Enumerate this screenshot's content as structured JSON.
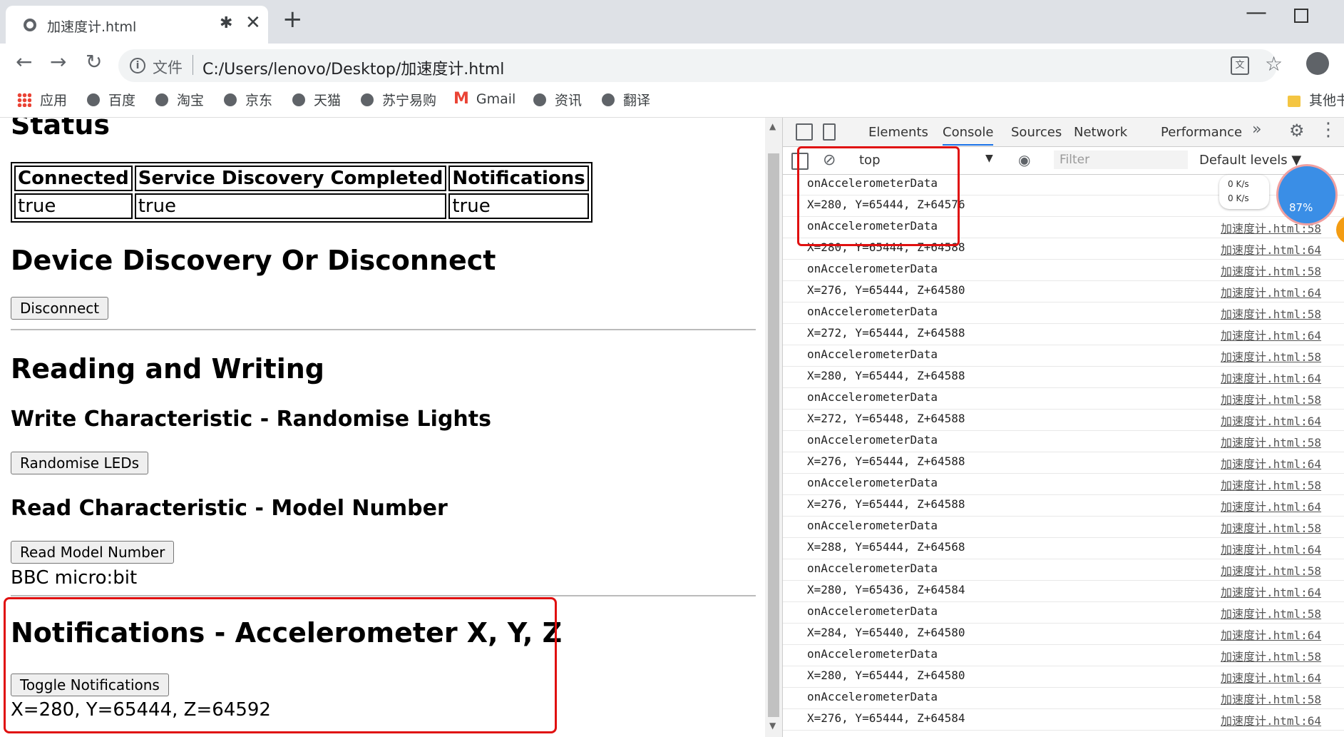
{
  "browser": {
    "tab_title": "加速度计.html",
    "tab_bt": "✱",
    "tab_close": "✕",
    "new_tab": "+",
    "file_label": "文件",
    "url": "C:/Users/lenovo/Desktop/加速度计.html",
    "bookmarks": [
      "应用",
      "百度",
      "淘宝",
      "京东",
      "天猫",
      "苏宁易购",
      "Gmail",
      "资讯",
      "翻译",
      "其他书"
    ]
  },
  "page": {
    "status_heading": "Status",
    "table_headers": [
      "Connected",
      "Service Discovery Completed",
      "Notifications"
    ],
    "table_values": [
      "true",
      "true",
      "true"
    ],
    "discovery_heading": "Device Discovery Or Disconnect",
    "disconnect_label": "Disconnect",
    "rw_heading": "Reading and Writing",
    "write_heading": "Write Characteristic - Randomise Lights",
    "randomise_label": "Randomise LEDs",
    "read_heading": "Read Characteristic - Model Number",
    "read_label": "Read Model Number",
    "model_number": "BBC micro:bit",
    "notif_heading": "Notifications - Accelerometer X, Y, Z",
    "toggle_label": "Toggle Notifications",
    "accel_reading": "X=280, Y=65444, Z=64592"
  },
  "devtools": {
    "tabs": [
      "Elements",
      "Console",
      "Sources",
      "Network",
      "Performance"
    ],
    "active_tab": "Console",
    "more_tabs": "»",
    "context": "top",
    "filter_placeholder": "Filter",
    "levels": "Default levels ▼",
    "speed_up": "0  K/s",
    "speed_down": "0  K/s",
    "ball_pct": "87%",
    "rows": [
      {
        "msg": "onAccelerometerData",
        "src": ""
      },
      {
        "msg": "X=280, Y=65444, Z+64576",
        "src": ""
      },
      {
        "msg": "onAccelerometerData",
        "src": "加速度计.html:58"
      },
      {
        "msg": "X=280, Y=65444, Z+64588",
        "src": "加速度计.html:64"
      },
      {
        "msg": "onAccelerometerData",
        "src": "加速度计.html:58"
      },
      {
        "msg": "X=276, Y=65444, Z+64580",
        "src": "加速度计.html:64"
      },
      {
        "msg": "onAccelerometerData",
        "src": "加速度计.html:58"
      },
      {
        "msg": "X=272, Y=65444, Z+64588",
        "src": "加速度计.html:64"
      },
      {
        "msg": "onAccelerometerData",
        "src": "加速度计.html:58"
      },
      {
        "msg": "X=280, Y=65444, Z+64588",
        "src": "加速度计.html:64"
      },
      {
        "msg": "onAccelerometerData",
        "src": "加速度计.html:58"
      },
      {
        "msg": "X=272, Y=65448, Z+64588",
        "src": "加速度计.html:64"
      },
      {
        "msg": "onAccelerometerData",
        "src": "加速度计.html:58"
      },
      {
        "msg": "X=276, Y=65444, Z+64588",
        "src": "加速度计.html:64"
      },
      {
        "msg": "onAccelerometerData",
        "src": "加速度计.html:58"
      },
      {
        "msg": "X=276, Y=65444, Z+64588",
        "src": "加速度计.html:64"
      },
      {
        "msg": "onAccelerometerData",
        "src": "加速度计.html:58"
      },
      {
        "msg": "X=288, Y=65444, Z+64568",
        "src": "加速度计.html:64"
      },
      {
        "msg": "onAccelerometerData",
        "src": "加速度计.html:58"
      },
      {
        "msg": "X=280, Y=65436, Z+64584",
        "src": "加速度计.html:64"
      },
      {
        "msg": "onAccelerometerData",
        "src": "加速度计.html:58"
      },
      {
        "msg": "X=284, Y=65440, Z+64580",
        "src": "加速度计.html:64"
      },
      {
        "msg": "onAccelerometerData",
        "src": "加速度计.html:58"
      },
      {
        "msg": "X=280, Y=65444, Z+64580",
        "src": "加速度计.html:64"
      },
      {
        "msg": "onAccelerometerData",
        "src": "加速度计.html:58"
      },
      {
        "msg": "X=276, Y=65444, Z+64584",
        "src": "加速度计.html:64"
      }
    ]
  },
  "colors": {
    "annotation_red": "#e01010",
    "link_blue": "#1a73e8"
  }
}
